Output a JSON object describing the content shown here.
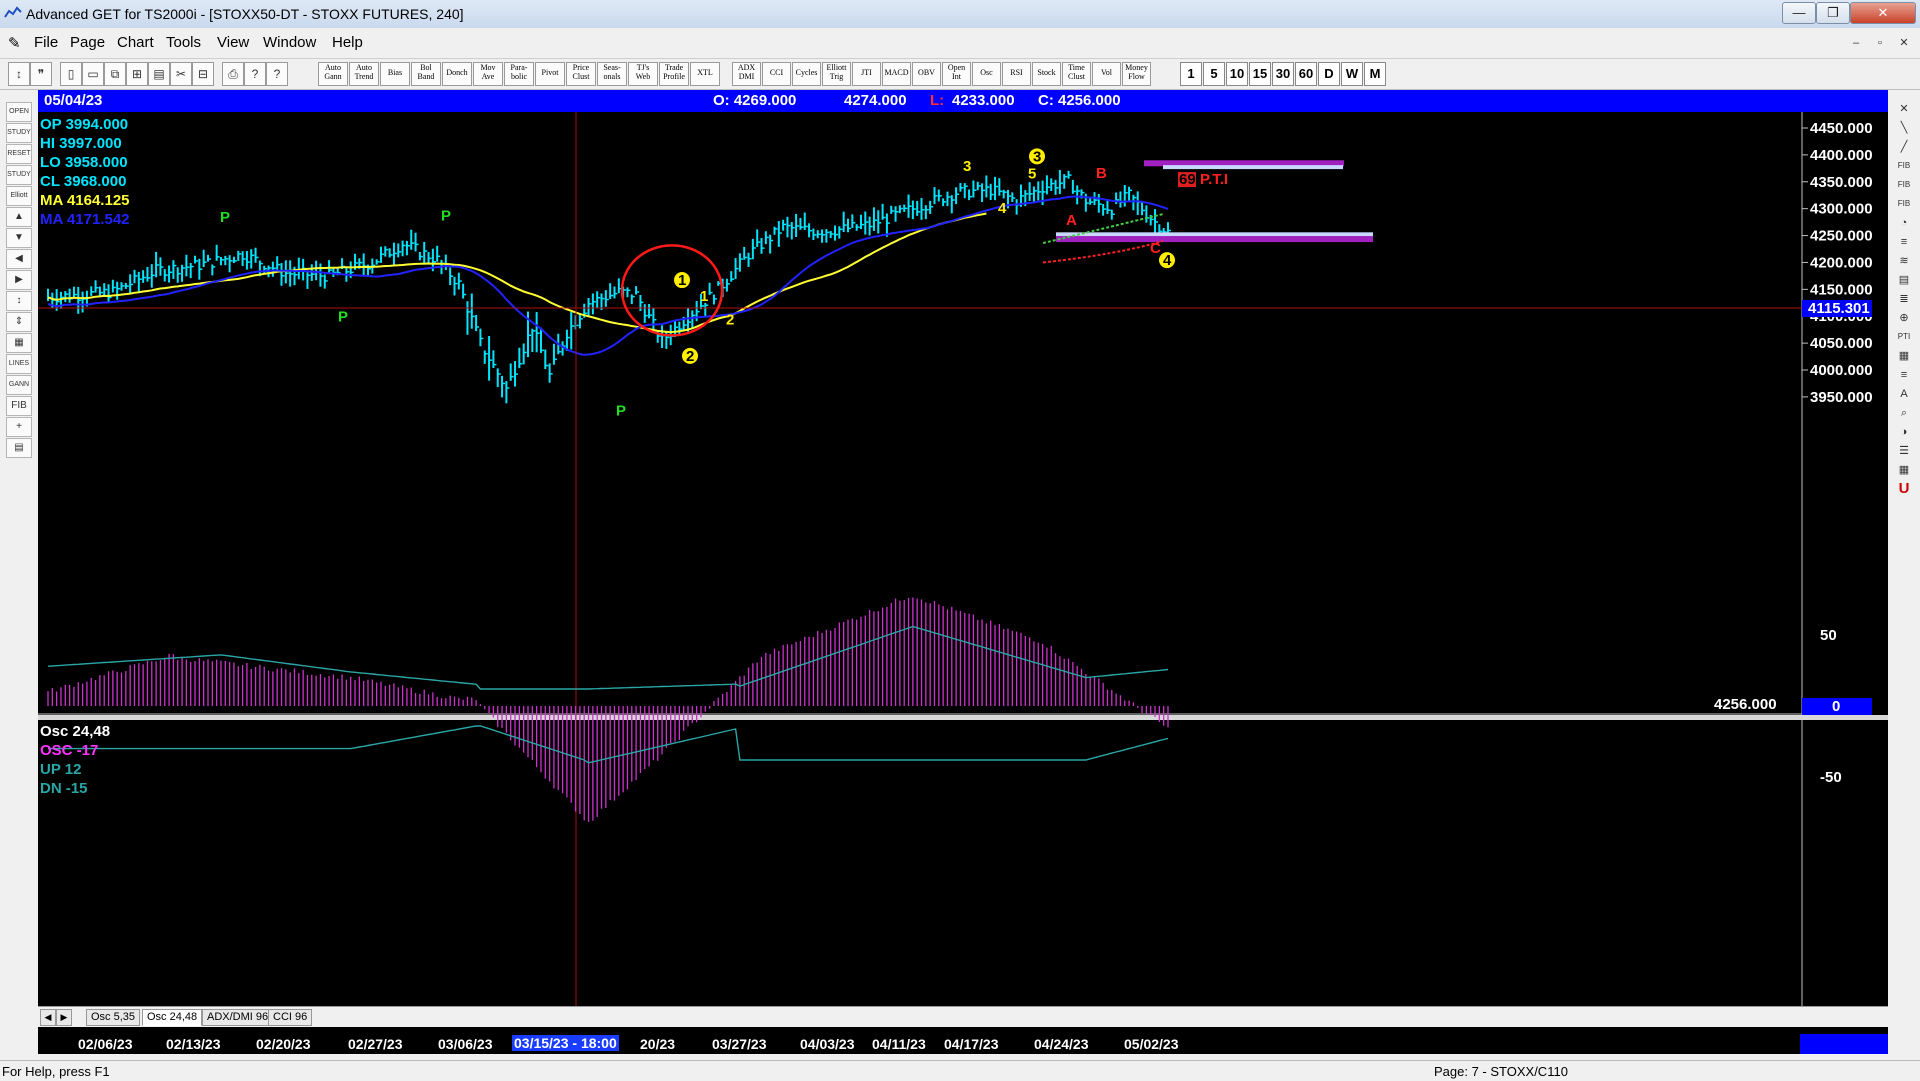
{
  "window": {
    "title": "Advanced GET for TS2000i - [STOXX50-DT - STOXX FUTURES, 240]",
    "controls": [
      "—",
      "❐",
      "✕"
    ]
  },
  "menu": {
    "items": [
      "File",
      "Page",
      "Chart",
      "Tools",
      "View",
      "Window",
      "Help"
    ],
    "mdi_controls": [
      "–",
      "▫",
      "✕"
    ]
  },
  "toolbar": {
    "icons": [
      "pencil-icon",
      "quote-icon",
      "new-page-icon",
      "open-icon",
      "copy-icon",
      "paste-icon",
      "layout-icon",
      "cut-icon",
      "arrange-icon",
      "print-icon",
      "info-icon",
      "help-icon"
    ],
    "study_buttons": [
      {
        "l1": "Auto",
        "l2": "Gann"
      },
      {
        "l1": "Auto",
        "l2": "Trend"
      },
      {
        "l1": "Bias",
        "l2": ""
      },
      {
        "l1": "Bol",
        "l2": "Band"
      },
      {
        "l1": "Donch",
        "l2": ""
      },
      {
        "l1": "Mov",
        "l2": "Ave"
      },
      {
        "l1": "Para-",
        "l2": "bolic"
      },
      {
        "l1": "Pivot",
        "l2": ""
      },
      {
        "l1": "Price",
        "l2": "Clust"
      },
      {
        "l1": "Seas-",
        "l2": "onals"
      },
      {
        "l1": "TJ's",
        "l2": "Web"
      },
      {
        "l1": "Trade",
        "l2": "Profile"
      },
      {
        "l1": "XTL",
        "l2": ""
      }
    ],
    "osc_buttons": [
      {
        "l1": "ADX",
        "l2": "DMI"
      },
      {
        "l1": "CCI",
        "l2": ""
      },
      {
        "l1": "Cycles",
        "l2": ""
      },
      {
        "l1": "Elliott",
        "l2": "Trig"
      },
      {
        "l1": "JTI",
        "l2": ""
      },
      {
        "l1": "MACD",
        "l2": ""
      },
      {
        "l1": "OBV",
        "l2": ""
      },
      {
        "l1": "Open",
        "l2": "Int"
      },
      {
        "l1": "Osc",
        "l2": ""
      },
      {
        "l1": "RSI",
        "l2": ""
      },
      {
        "l1": "Stock",
        "l2": ""
      },
      {
        "l1": "Time",
        "l2": "Clust"
      },
      {
        "l1": "Vol",
        "l2": ""
      },
      {
        "l1": "Money",
        "l2": "Flow"
      }
    ],
    "timeframes": [
      "1",
      "5",
      "10",
      "15",
      "30",
      "60",
      "D",
      "W",
      "M"
    ]
  },
  "left_tools": [
    "OPEN",
    "STUDY",
    "RESET",
    "STUDY",
    "Elliott",
    "▲",
    "▼",
    "◀",
    "▶",
    "↕",
    "⇕",
    "▦",
    "LINES",
    "GANN",
    "FIB",
    "+",
    "▤"
  ],
  "right_tools": [
    "✕",
    "╲",
    "╱",
    "FIB",
    "FIB",
    "FIB",
    "◔",
    "≡",
    "≋",
    "▤",
    "≣",
    "⊕",
    "PTI",
    "▦",
    "≡",
    "A",
    "⌕",
    "◑",
    "☰",
    "▦",
    "U"
  ],
  "info_bar": {
    "date": "05/04/23",
    "open": "O: 4269.000",
    "high": "4274.000",
    "low_label": "L:",
    "low_value": "4233.000",
    "close": "C: 4256.000"
  },
  "legend": {
    "op": "OP  3994.000",
    "hi": "HI   3997.000",
    "lo": "LO  3958.000",
    "cl": "CL  3968.000",
    "ma1": "MA  4164.125",
    "ma2": "MA  4171.542"
  },
  "price_axis": {
    "ticks": [
      "4450.000",
      "4400.000",
      "4350.000",
      "4300.000",
      "4250.000",
      "4200.000",
      "4150.000",
      "4100.000",
      "4050.000",
      "4000.000",
      "3950.000"
    ],
    "crosshair_value": "4115.301",
    "last_price": "4256.000"
  },
  "annotations": {
    "pivots": [
      "P",
      "P",
      "P",
      "P"
    ],
    "wave_count": [
      "3",
      "5",
      "3",
      "4",
      "1",
      "1",
      "2",
      "2",
      "4"
    ],
    "abc": [
      "A",
      "B",
      "C"
    ],
    "pti_value": "69",
    "pti_label": "P.T.I"
  },
  "oscillator": {
    "title": "Osc 24,48",
    "osc": "OSC -17",
    "up": "UP   12",
    "dn": "DN   -15",
    "axis": [
      "50",
      "0",
      "-50"
    ]
  },
  "osc_tabs": [
    "Osc 5,35",
    "Osc 24,48",
    "ADX/DMI 96",
    "CCI 96"
  ],
  "date_axis": {
    "labels": [
      "02/06/23",
      "02/13/23",
      "02/20/23",
      "02/27/23",
      "03/06/23",
      "20/23",
      "03/27/23",
      "04/03/23",
      "04/11/23",
      "04/17/23",
      "04/24/23",
      "05/02/23"
    ],
    "cursor": "03/15/23 - 18:00"
  },
  "status": {
    "left": "For Help, press F1",
    "right": "Page: 7 - STOXX/C110"
  },
  "colors": {
    "background": "#000000",
    "bars": "#00e5ff",
    "ma_fast": "#ffff33",
    "ma_slow": "#2222ff",
    "osc_hist": "#cc33cc",
    "bands": "#2aa6a6",
    "accent_blue": "#0000ff",
    "wave_yellow": "#ffee00",
    "red": "#ff2020"
  }
}
